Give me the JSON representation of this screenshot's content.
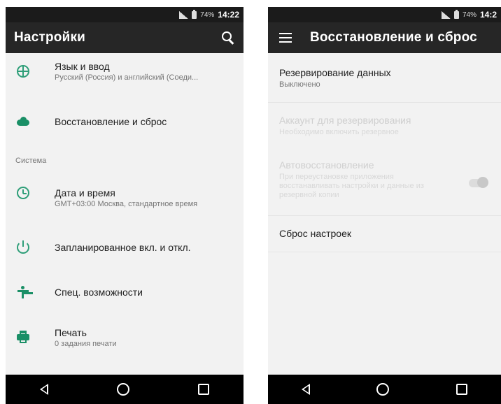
{
  "left": {
    "status": {
      "battery": "74%",
      "time": "14:22"
    },
    "app_bar": {
      "title": "Настройки"
    },
    "items": [
      {
        "title": "Язык и ввод",
        "subtitle": "Русский (Россия) и английский (Соеди..."
      },
      {
        "title": "Восстановление и сброс"
      },
      {
        "title": "Дата и время",
        "subtitle": "GMT+03:00 Москва, стандартное время"
      },
      {
        "title": "Запланированное вкл. и откл."
      },
      {
        "title": "Спец. возможности"
      },
      {
        "title": "Печать",
        "subtitle": "0 задания печати"
      }
    ],
    "section_system": "Система",
    "icons": [
      "globe-icon",
      "cloud-icon",
      "clock-icon",
      "power-icon",
      "accessibility-icon",
      "print-icon"
    ]
  },
  "right": {
    "status": {
      "battery": "74%",
      "time": "14:2"
    },
    "app_bar": {
      "title": "Восстановление и сброс"
    },
    "items": [
      {
        "title": "Резервирование данных",
        "subtitle": "Выключено",
        "enabled": true
      },
      {
        "title": "Аккаунт для резервирования",
        "subtitle": "Необходимо включить резервное",
        "enabled": false
      },
      {
        "title": "Автовосстановление",
        "subtitle": "При переустановке приложения восстанавливать настройки и данные из резервной копии",
        "enabled": false
      },
      {
        "title": "Сброс настроек",
        "enabled": true
      }
    ]
  },
  "colors": {
    "accent": "#1a8f66",
    "app_bar": "#262626",
    "status_bar": "#1b1b1b",
    "background": "#f2f2f2"
  }
}
